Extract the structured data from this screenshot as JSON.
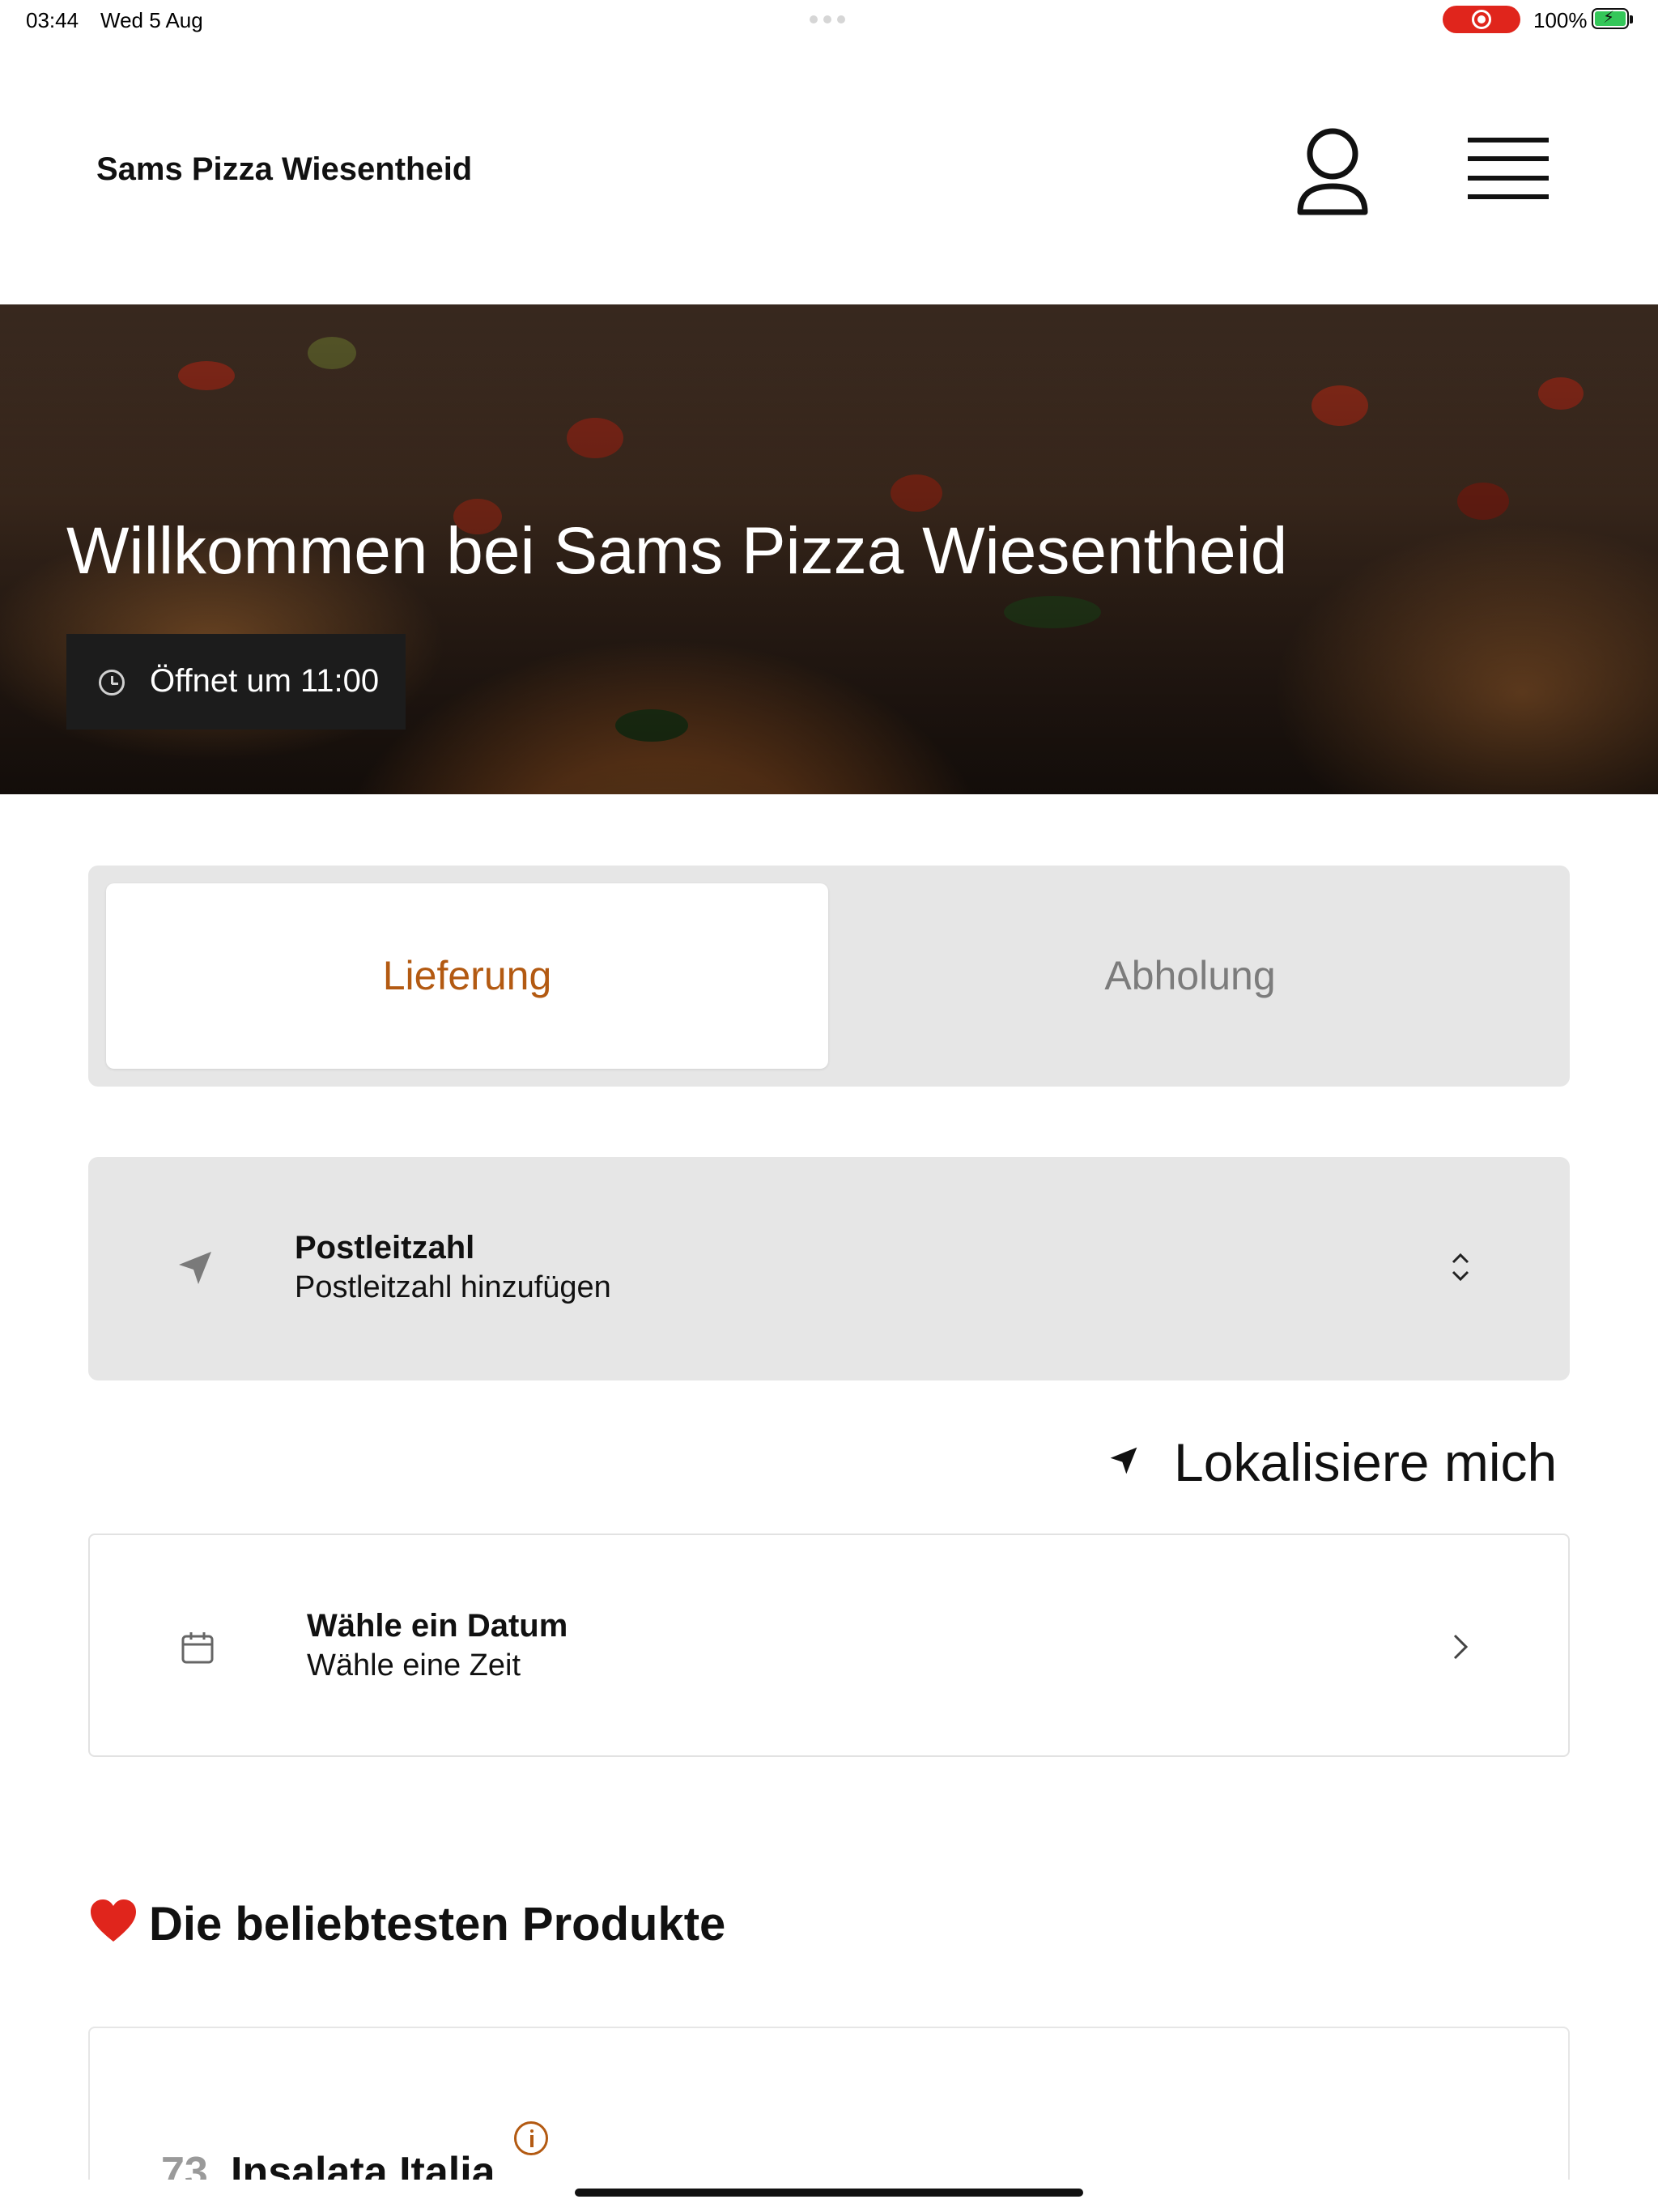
{
  "status_bar": {
    "time": "03:44",
    "date": "Wed 5 Aug",
    "battery_percent": "100%",
    "battery_level": 1.0,
    "recording": true,
    "colors": {
      "record": "#e0251c",
      "battery": "#34c759"
    }
  },
  "header": {
    "title": "Sams Pizza Wiesentheid",
    "icons": [
      "profile-icon",
      "hamburger-menu-icon"
    ]
  },
  "hero": {
    "title": "Willkommen bei Sams Pizza Wiesentheid",
    "status_badge": "Öffnet um 11:00",
    "status_icon": "clock-icon"
  },
  "mode_selector": {
    "options": [
      "Lieferung",
      "Abholung"
    ],
    "selected": "Lieferung",
    "colors": {
      "active_text": "#b35a12",
      "inactive_text": "#7c7c7c"
    }
  },
  "postcode": {
    "title": "Postleitzahl",
    "placeholder": "Postleitzahl hinzufügen",
    "icon": "navigation-arrow-icon"
  },
  "locate": {
    "label": "Lokalisiere mich",
    "icon": "navigation-arrow-icon"
  },
  "schedule": {
    "title": "Wähle ein Datum",
    "subtitle": "Wähle eine Zeit",
    "icon": "calendar-icon"
  },
  "popular": {
    "title": "Die beliebtesten Produkte",
    "icon": "heart-icon",
    "products": [
      {
        "number": "73",
        "name": "Insalata Italia"
      }
    ]
  },
  "accent_color": "#b35a12"
}
